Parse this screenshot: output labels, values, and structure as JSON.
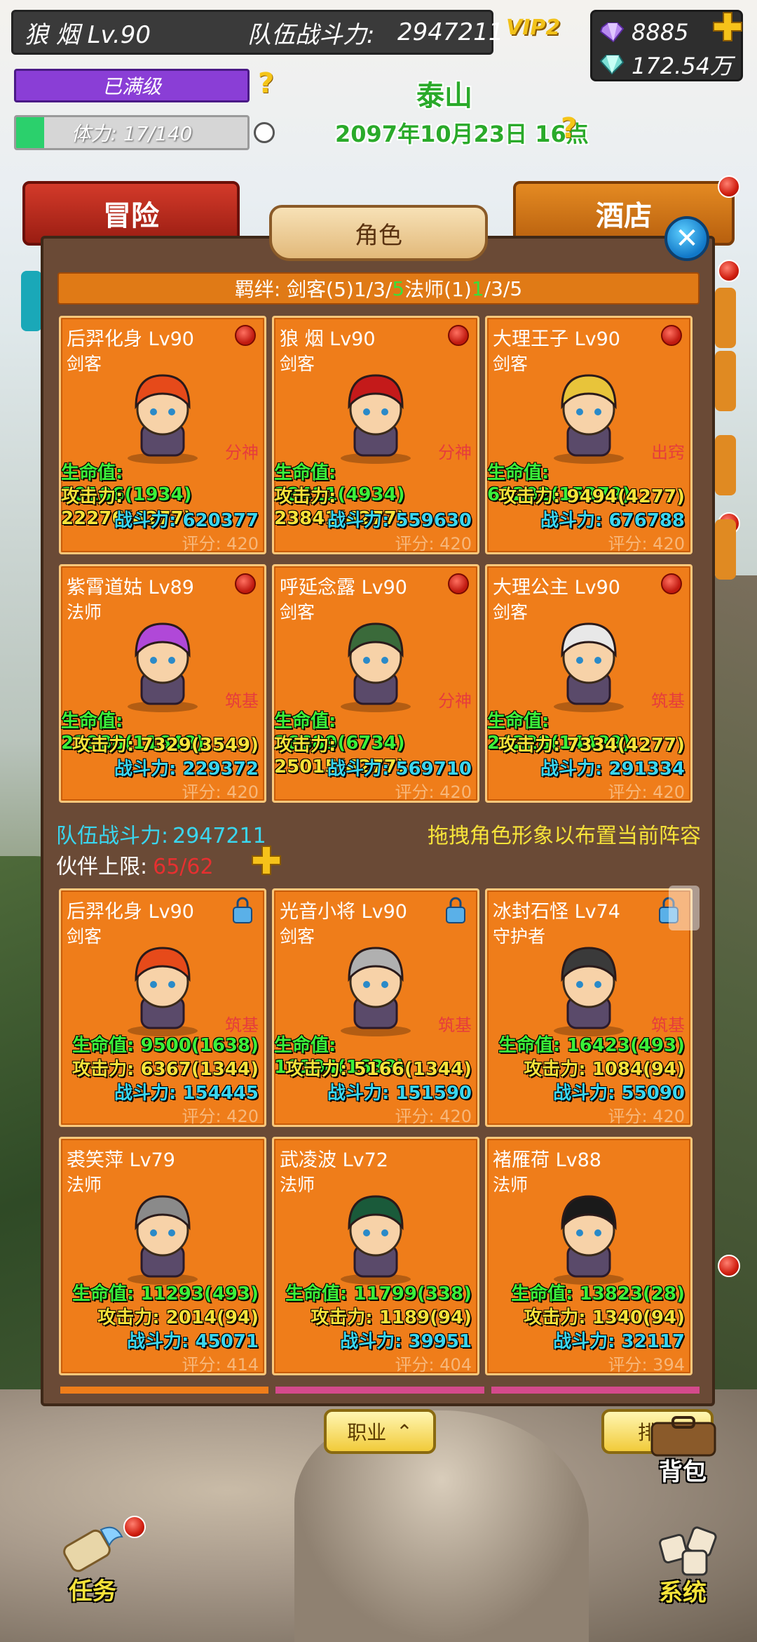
{
  "hud": {
    "player_name": "狼 烟 Lv.90",
    "team_power_label": "队伍战斗力:",
    "team_power_value": "2947211",
    "vip": "VIP2",
    "gems": "8885",
    "silver": "172.54万",
    "level_status": "已满级",
    "stamina_text": "体力: 17/140",
    "stamina_fraction": 0.121,
    "location": "泰山",
    "datetime": "2097年10月23日 16点"
  },
  "nav": {
    "adventure": "冒险",
    "hotel": "酒店"
  },
  "panel": {
    "title": "角色",
    "bond_prefix": "羁绊: 剑客(5)1/3/",
    "bond_green1": "5",
    "bond_mid": " 法师(1)",
    "bond_green2": "1",
    "bond_suffix": "/3/5",
    "team_power_label": "队伍战斗力:",
    "team_power_value": "2947211",
    "drag_tip": "拖拽角色形象以布置当前阵容",
    "partner_label": "伙伴上限:",
    "partner_count": "65/62"
  },
  "team": [
    {
      "name": "后羿化身 Lv90",
      "class": "剑客",
      "status": "分神",
      "hp": "生命值: 30106(1934)",
      "atk": "攻击力: 22276(4277)",
      "cp": "战斗力: 620377",
      "score": "评分: 420",
      "color": "#e64a1a"
    },
    {
      "name": "狼 烟 Lv90",
      "class": "剑客",
      "status": "分神",
      "hp": "生命值: 28411(4934)",
      "atk": "攻击力: 23841(4277)",
      "cp": "战斗力: 559630",
      "score": "评分: 420",
      "color": "#c41a1a"
    },
    {
      "name": "大理王子 Lv90",
      "class": "剑客",
      "status": "出窍",
      "hp": "生命值: 68202(15379)",
      "atk": "攻击力: 9494(4277)",
      "cp": "战斗力: 676788",
      "score": "评分: 420",
      "color": "#e8c43a"
    },
    {
      "name": "紫霄道姑 Lv89",
      "class": "法师",
      "status": "筑基",
      "hp": "生命值: 22988(11648)",
      "atk": "攻击力: 7329(3549)",
      "cp": "战斗力: 229372",
      "score": "评分: 420",
      "color": "#b048d8"
    },
    {
      "name": "呼延念露 Lv90",
      "class": "剑客",
      "status": "分神",
      "hp": "生命值: 26689(6734)",
      "atk": "攻击力: 25015(4277)",
      "cp": "战斗力: 569710",
      "score": "评分: 420",
      "color": "#3a6a3a"
    },
    {
      "name": "大理公主 Lv90",
      "class": "剑客",
      "status": "筑基",
      "hp": "生命值: 24228(14489)",
      "atk": "攻击力: 7334(4277)",
      "cp": "战斗力: 291334",
      "score": "评分: 420",
      "color": "#e8e8e8"
    }
  ],
  "roster": [
    {
      "name": "后羿化身 Lv90",
      "class": "剑客",
      "status": "筑基",
      "hp": "生命值: 9500(1638)",
      "atk": "攻击力: 6367(1344)",
      "cp": "战斗力: 154445",
      "score": "评分: 420",
      "color": "#e64a1a",
      "locked": true
    },
    {
      "name": "光音小将 Lv90",
      "class": "剑客",
      "status": "筑基",
      "hp": "生命值: 10104(1638)",
      "atk": "攻击力: 5166(1344)",
      "cp": "战斗力: 151590",
      "score": "评分: 420",
      "color": "#b0b0b0",
      "locked": true
    },
    {
      "name": "冰封石怪 Lv74",
      "class": "守护者",
      "status": "筑基",
      "hp": "生命值: 16423(493)",
      "atk": "攻击力: 1084(94)",
      "cp": "战斗力: 55090",
      "score": "评分: 420",
      "color": "#3a3a3a",
      "locked": true
    },
    {
      "name": "裘笑萍 Lv79",
      "class": "法师",
      "status": "",
      "hp": "生命值: 11293(493)",
      "atk": "攻击力: 2014(94)",
      "cp": "战斗力: 45071",
      "score": "评分: 414",
      "color": "#8a8a8a",
      "locked": false
    },
    {
      "name": "武凌波 Lv72",
      "class": "法师",
      "status": "",
      "hp": "生命值: 11799(338)",
      "atk": "攻击力: 1189(94)",
      "cp": "战斗力: 39951",
      "score": "评分: 404",
      "color": "#1a5a3a",
      "locked": false
    },
    {
      "name": "褚雁荷 Lv88",
      "class": "法师",
      "status": "",
      "hp": "生命值: 13823(28)",
      "atk": "攻击力: 1340(94)",
      "cp": "战斗力: 32117",
      "score": "评分: 394",
      "color": "#1a1a1a",
      "locked": false
    }
  ],
  "bottom": {
    "job_label": "职业",
    "sort_label": "排序",
    "bag_label": "背包",
    "task_label": "任务",
    "system_label": "系统"
  },
  "colors": {
    "card_bg": "#ef7d1a",
    "hp": "#3bf03a",
    "atk": "#f6e33a",
    "cp": "#3ad6ef"
  }
}
